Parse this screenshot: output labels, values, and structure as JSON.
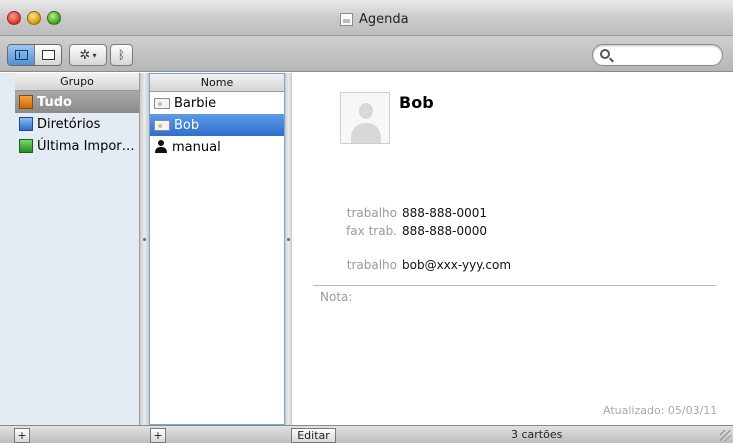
{
  "window": {
    "title": "Agenda"
  },
  "toolbar": {
    "view_toggle": [
      "card-and-list-view-icon",
      "card-only-view-icon"
    ],
    "action_menu": "gear-icon",
    "bluetooth": "bluetooth-icon",
    "search": {
      "placeholder": "",
      "value": ""
    }
  },
  "groups": {
    "header": "Grupo",
    "items": [
      {
        "label": "Tudo",
        "icon": "group-icon",
        "selected": true
      },
      {
        "label": "Diretórios",
        "icon": "directory-icon",
        "selected": false
      },
      {
        "label": "Última Impor…",
        "icon": "last-import-icon",
        "selected": false
      }
    ]
  },
  "names": {
    "header": "Nome",
    "items": [
      {
        "label": "Barbie",
        "icon": "card-icon",
        "selected": false
      },
      {
        "label": "Bob",
        "icon": "card-icon",
        "selected": true
      },
      {
        "label": "manual",
        "icon": "person-icon",
        "selected": false
      }
    ]
  },
  "card": {
    "name": "Bob",
    "phones": [
      {
        "label": "trabalho",
        "value": "888-888-0001"
      },
      {
        "label": "fax trab.",
        "value": "888-888-0000"
      }
    ],
    "emails": [
      {
        "label": "trabalho",
        "value": "bob@xxx-yyy.com"
      }
    ],
    "note_label": "Nota:",
    "updated": "Atualizado: 05/03/11"
  },
  "bottom": {
    "add_group": "+",
    "add_contact": "+",
    "edit": "Editar",
    "count": "3 cartões"
  },
  "colors": {
    "selection_blue": "#3b7fd9",
    "selection_gray": "#9a9a9a",
    "label_gray": "#9a9a9a"
  }
}
